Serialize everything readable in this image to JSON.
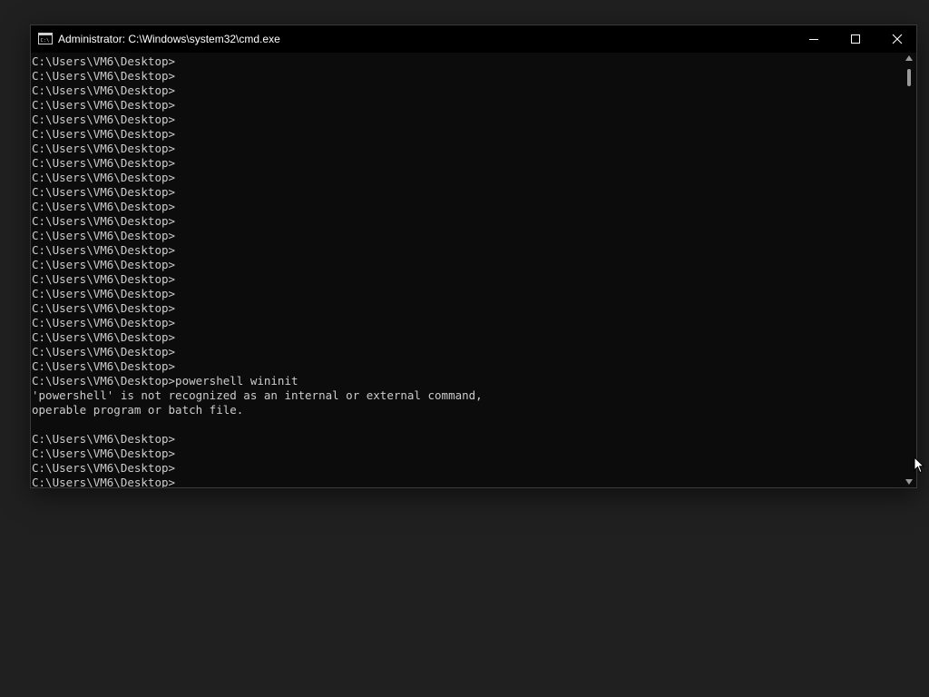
{
  "window": {
    "title": "Administrator: C:\\Windows\\system32\\cmd.exe",
    "icon": "cmd-icon"
  },
  "caption_buttons": {
    "minimize": "minimize-icon",
    "maximize": "maximize-icon",
    "close": "close-icon"
  },
  "console": {
    "lines": [
      "C:\\Users\\VM6\\Desktop>",
      "C:\\Users\\VM6\\Desktop>",
      "C:\\Users\\VM6\\Desktop>",
      "C:\\Users\\VM6\\Desktop>",
      "C:\\Users\\VM6\\Desktop>",
      "C:\\Users\\VM6\\Desktop>",
      "C:\\Users\\VM6\\Desktop>",
      "C:\\Users\\VM6\\Desktop>",
      "C:\\Users\\VM6\\Desktop>",
      "C:\\Users\\VM6\\Desktop>",
      "C:\\Users\\VM6\\Desktop>",
      "C:\\Users\\VM6\\Desktop>",
      "C:\\Users\\VM6\\Desktop>",
      "C:\\Users\\VM6\\Desktop>",
      "C:\\Users\\VM6\\Desktop>",
      "C:\\Users\\VM6\\Desktop>",
      "C:\\Users\\VM6\\Desktop>",
      "C:\\Users\\VM6\\Desktop>",
      "C:\\Users\\VM6\\Desktop>",
      "C:\\Users\\VM6\\Desktop>",
      "C:\\Users\\VM6\\Desktop>",
      "C:\\Users\\VM6\\Desktop>",
      "C:\\Users\\VM6\\Desktop>powershell wininit",
      "'powershell' is not recognized as an internal or external command,",
      "operable program or batch file.",
      "",
      "C:\\Users\\VM6\\Desktop>",
      "C:\\Users\\VM6\\Desktop>",
      "C:\\Users\\VM6\\Desktop>",
      "C:\\Users\\VM6\\Desktop>"
    ]
  },
  "colors": {
    "console_background": "#0c0c0c",
    "console_text": "#cccccc",
    "titlebar_background": "#000000",
    "desktop_background": "#202020"
  }
}
